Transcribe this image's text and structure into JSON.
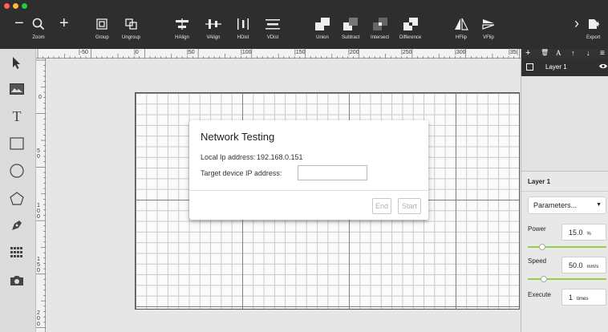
{
  "toolbar": {
    "zoom_label": "Zoom",
    "group_label": "Group",
    "ungroup_label": "Ungroup",
    "halign_label": "HAlign",
    "valign_label": "VAlign",
    "hdist_label": "HDist",
    "vdist_label": "VDist",
    "union_label": "Union",
    "subtract_label": "Subtract",
    "intersect_label": "Intersect",
    "difference_label": "Difference",
    "hflip_label": "HFlip",
    "vflip_label": "VFlip",
    "export_label": "Export",
    "zoom_out_symbol": "−",
    "zoom_in_symbol": "+",
    "more_symbol": "›"
  },
  "ruler": {
    "h_labels": [
      "|-50",
      "|0",
      "|50",
      "|100",
      "|150",
      "|200",
      "|250",
      "|300",
      "|35("
    ],
    "v_labels": [
      "0",
      "5 0",
      "1 0 0",
      "1 5 0",
      "2 0 0"
    ]
  },
  "dialog": {
    "title": "Network Testing",
    "local_ip_label": "Local Ip address:",
    "local_ip_value": "192.168.0.151",
    "target_ip_label": "Target device IP address:",
    "target_ip_value": "",
    "end_label": "End",
    "start_label": "Start"
  },
  "layers_panel": {
    "toolbar_icons": [
      "+",
      "🗑",
      "A",
      "↑",
      "↓",
      "≡"
    ],
    "layer_name": "Layer 1",
    "eye_symbol": "👁"
  },
  "properties": {
    "title": "Layer 1",
    "mode": "Parameters...",
    "power_label": "Power",
    "power_value": "15.0",
    "power_unit": "%",
    "power_fraction": 0.15,
    "speed_label": "Speed",
    "speed_value": "50.0",
    "speed_unit": "mm/s",
    "speed_fraction": 0.18,
    "execute_label": "Execute",
    "execute_value": "1",
    "execute_unit": "times"
  },
  "colors": {
    "toolbar_bg": "#2e2e2e",
    "slider_accent": "#8ed14a",
    "grid_bg": "#fbfbfb"
  },
  "icons": {
    "toolbox": [
      "cursor-icon",
      "image-icon",
      "text-icon",
      "rectangle-icon",
      "circle-icon",
      "polygon-icon",
      "pen-icon",
      "grid-array-icon",
      "camera-icon"
    ]
  }
}
